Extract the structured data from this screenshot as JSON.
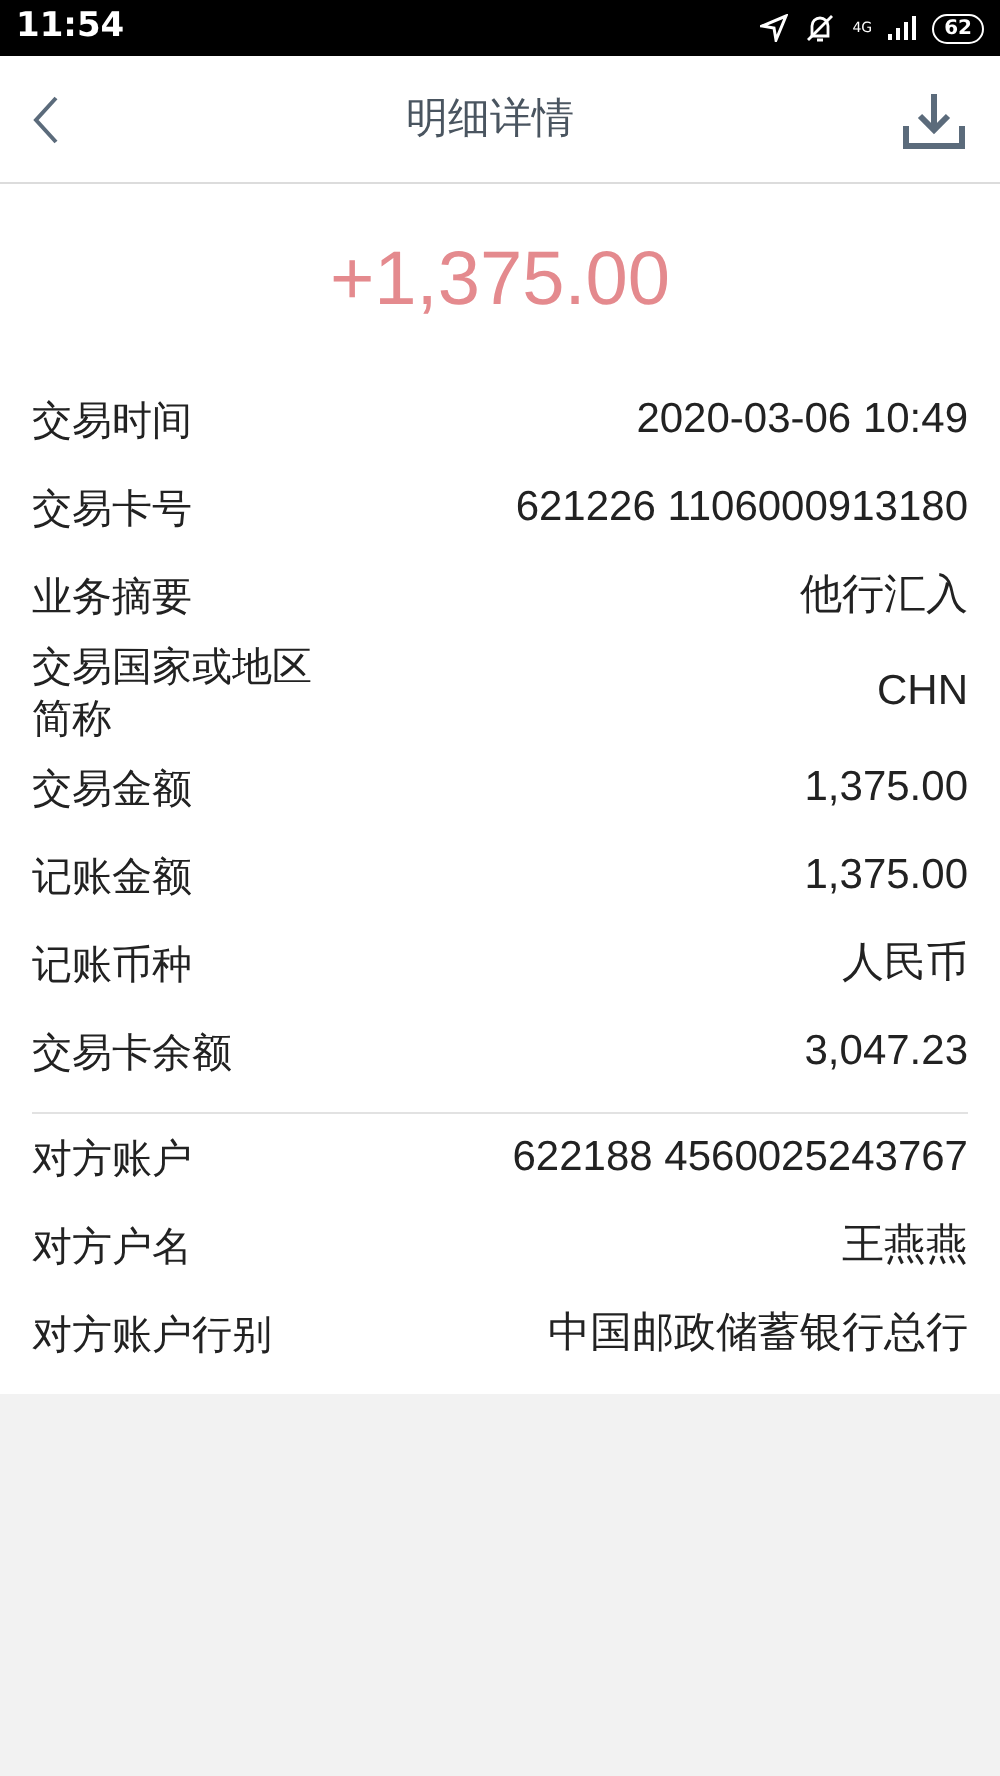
{
  "status_bar": {
    "time": "11:54",
    "network": "4G",
    "battery": "62"
  },
  "header": {
    "title": "明细详情"
  },
  "amount": "+1,375.00",
  "sections": [
    {
      "rows": [
        {
          "label": "交易时间",
          "value": "2020-03-06 10:49"
        },
        {
          "label": "交易卡号",
          "value": "621226 1106000913180"
        },
        {
          "label": "业务摘要",
          "value": "他行汇入"
        },
        {
          "label": "交易国家或地区简称",
          "value": "CHN"
        },
        {
          "label": "交易金额",
          "value": "1,375.00"
        },
        {
          "label": "记账金额",
          "value": "1,375.00"
        },
        {
          "label": "记账币种",
          "value": "人民币"
        },
        {
          "label": "交易卡余额",
          "value": "3,047.23"
        }
      ]
    },
    {
      "rows": [
        {
          "label": "对方账户",
          "value": "622188 4560025243767"
        },
        {
          "label": "对方户名",
          "value": "王燕燕"
        },
        {
          "label": "对方账户行别",
          "value": "中国邮政储蓄银行总行"
        }
      ]
    }
  ]
}
